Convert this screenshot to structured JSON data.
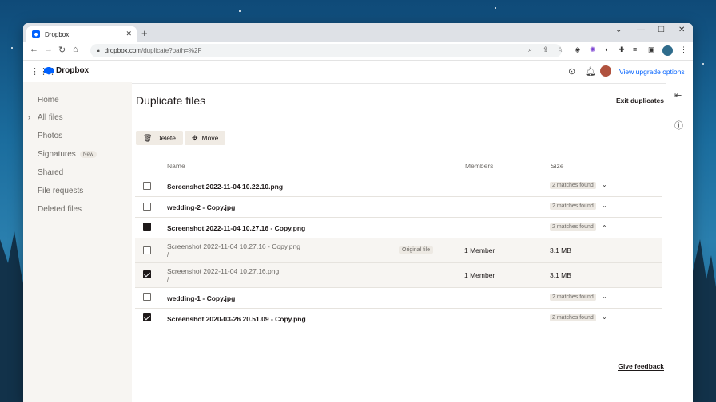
{
  "browser": {
    "tab_title": "Dropbox",
    "tab_close": "✕",
    "new_tab": "+",
    "url_host": "dropbox.com",
    "url_path": "/duplicate?path=%2F",
    "window_controls": [
      "⌄",
      "—",
      "☐",
      "✕"
    ]
  },
  "app": {
    "logo_text": "Dropbox",
    "upgrade_link": "View upgrade options"
  },
  "sidebar": {
    "items": [
      {
        "label": "Home"
      },
      {
        "label": "All files"
      },
      {
        "label": "Photos"
      },
      {
        "label": "Signatures",
        "badge": "New"
      },
      {
        "label": "Shared"
      },
      {
        "label": "File requests"
      },
      {
        "label": "Deleted files"
      }
    ]
  },
  "main": {
    "title": "Duplicate files",
    "exit_label": "Exit duplicates",
    "delete_label": "Delete",
    "move_label": "Move",
    "columns": {
      "name": "Name",
      "members": "Members",
      "size": "Size"
    },
    "rows": [
      {
        "name": "Screenshot 2022-11-04 10.22.10.png",
        "matches": "2 matches found",
        "chevron": "⌄",
        "state": "unchecked"
      },
      {
        "name": "wedding-2 - Copy.jpg",
        "matches": "2 matches found",
        "chevron": "⌄",
        "state": "unchecked"
      },
      {
        "name": "Screenshot 2022-11-04 10.27.16 - Copy.png",
        "matches": "2 matches found",
        "chevron": "⌃",
        "state": "indeterminate"
      },
      {
        "name": "Screenshot 2022-11-04 10.27.16 - Copy.png",
        "path": "/",
        "tag": "Original file",
        "members": "1 Member",
        "size": "3.1 MB",
        "state": "unchecked",
        "sub": true
      },
      {
        "name": "Screenshot 2022-11-04 10.27.16.png",
        "path": "/",
        "members": "1 Member",
        "size": "3.1 MB",
        "state": "checked",
        "sub": true
      },
      {
        "name": "wedding-1 - Copy.jpg",
        "matches": "2 matches found",
        "chevron": "⌄",
        "state": "unchecked"
      },
      {
        "name": "Screenshot 2020-03-26 20.51.09 - Copy.png",
        "matches": "2 matches found",
        "chevron": "⌄",
        "state": "checked"
      }
    ],
    "feedback_label": "Give feedback"
  },
  "colors": {
    "accent": "#0061fe",
    "sidebar_bg": "#f7f5f2",
    "text": "#1e1919"
  }
}
